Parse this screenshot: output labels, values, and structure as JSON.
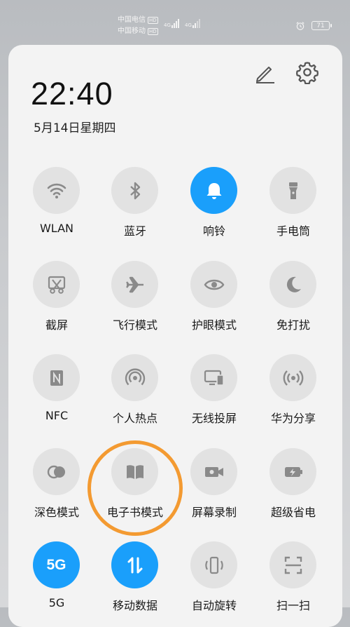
{
  "status": {
    "carrier1": "中国电信",
    "carrier2": "中国移动",
    "hd": "HD",
    "network": "4G",
    "battery": "71"
  },
  "header": {
    "time": "22:40",
    "date": "5月14日星期四"
  },
  "colors": {
    "accent": "#1a9ffb",
    "tile_off": "#e2e2e2",
    "icon_off": "#8a8a8a",
    "highlight_ring": "#f39a31"
  },
  "tiles": [
    {
      "label": "WLAN",
      "icon": "wifi-icon",
      "active": false
    },
    {
      "label": "蓝牙",
      "icon": "bluetooth-icon",
      "active": false
    },
    {
      "label": "响铃",
      "icon": "bell-icon",
      "active": true
    },
    {
      "label": "手电筒",
      "icon": "flashlight-icon",
      "active": false
    },
    {
      "label": "截屏",
      "icon": "screenshot-icon",
      "active": false
    },
    {
      "label": "飞行模式",
      "icon": "airplane-icon",
      "active": false
    },
    {
      "label": "护眼模式",
      "icon": "eye-icon",
      "active": false
    },
    {
      "label": "免打扰",
      "icon": "moon-icon",
      "active": false
    },
    {
      "label": "NFC",
      "icon": "nfc-icon",
      "active": false
    },
    {
      "label": "个人热点",
      "icon": "hotspot-icon",
      "active": false
    },
    {
      "label": "无线投屏",
      "icon": "cast-icon",
      "active": false
    },
    {
      "label": "华为分享",
      "icon": "share-icon",
      "active": false
    },
    {
      "label": "深色模式",
      "icon": "dark-mode-icon",
      "active": false
    },
    {
      "label": "电子书模式",
      "icon": "book-icon",
      "active": false
    },
    {
      "label": "屏幕录制",
      "icon": "record-icon",
      "active": false
    },
    {
      "label": "超级省电",
      "icon": "battery-saver-icon",
      "active": false
    },
    {
      "label": "5G",
      "icon": "5g-icon",
      "icon_text": "5G",
      "active": true
    },
    {
      "label": "移动数据",
      "icon": "mobile-data-icon",
      "active": true
    },
    {
      "label": "自动旋转",
      "icon": "rotate-icon",
      "active": false
    },
    {
      "label": "扫一扫",
      "icon": "scan-icon",
      "active": false
    }
  ]
}
